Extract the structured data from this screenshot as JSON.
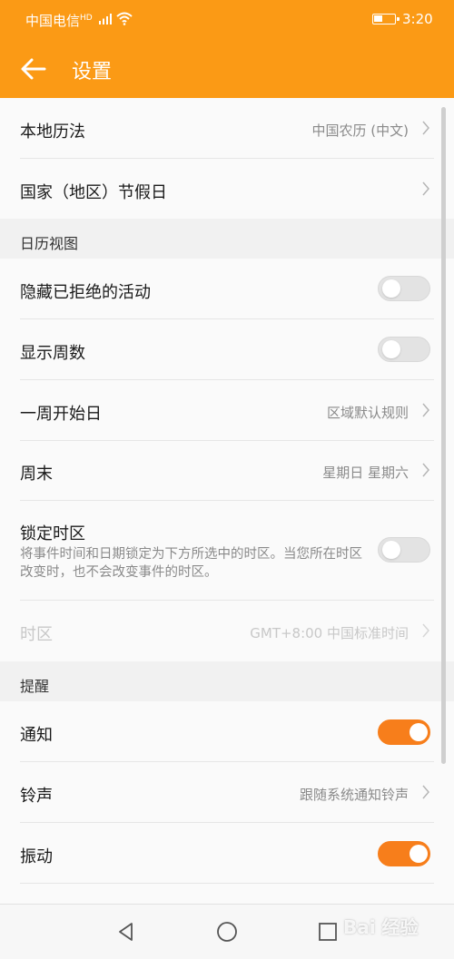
{
  "status_bar": {
    "carrier": "中国电信",
    "network_badge": "HD",
    "time": "3:20"
  },
  "app_bar": {
    "title": "设置",
    "back_icon": "arrow-left-icon"
  },
  "rows": {
    "local_calendar": {
      "label": "本地历法",
      "value": "中国农历 (中文)"
    },
    "holidays": {
      "label": "国家（地区）节假日"
    },
    "hide_declined": {
      "label": "隐藏已拒绝的活动",
      "on": false
    },
    "show_week_numbers": {
      "label": "显示周数",
      "on": false
    },
    "week_start": {
      "label": "一周开始日",
      "value": "区域默认规则"
    },
    "weekend": {
      "label": "周末",
      "value": "星期日 星期六"
    },
    "lock_timezone": {
      "label": "锁定时区",
      "description": "将事件时间和日期锁定为下方所选中的时区。当您所在时区改变时，也不会改变事件的时区。",
      "on": false
    },
    "timezone": {
      "label": "时区",
      "value": "GMT+8:00 中国标准时间",
      "disabled": true
    },
    "notification": {
      "label": "通知",
      "on": true
    },
    "ringtone": {
      "label": "铃声",
      "value": "跟随系统通知铃声"
    },
    "vibration": {
      "label": "振动",
      "on": true
    }
  },
  "sections": {
    "calendar_view": "日历视图",
    "reminders": "提醒"
  },
  "nav_bar": [
    "back-triangle-icon",
    "home-circle-icon",
    "recents-square-icon"
  ],
  "watermark": "Bai 经验",
  "colors": {
    "accent": "#fb9a15",
    "toggle_on": "#f77e1b",
    "toggle_off": "#e3e3e3"
  }
}
